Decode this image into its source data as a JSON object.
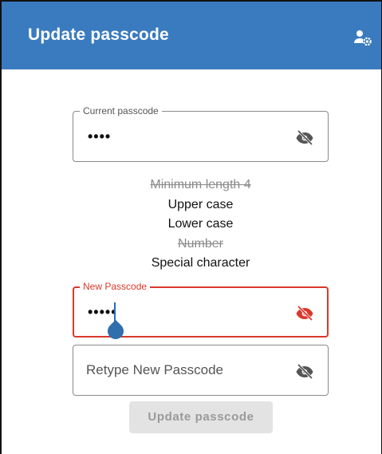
{
  "app_bar": {
    "title": "Update passcode",
    "background_color": "#3a7bbf",
    "action_icon": "account-settings-icon"
  },
  "current_passcode": {
    "label": "Current passcode",
    "value": "••••",
    "toggle_icon": "eye-off-icon"
  },
  "requirements": [
    {
      "text": "Minimum length 4",
      "met": true
    },
    {
      "text": "Upper case",
      "met": false
    },
    {
      "text": "Lower case",
      "met": false
    },
    {
      "text": "Number",
      "met": true
    },
    {
      "text": "Special character",
      "met": false
    }
  ],
  "new_passcode": {
    "label": "New Passcode",
    "value": "•••••",
    "state": "error",
    "accent_color": "#d9392b",
    "toggle_icon": "eye-off-icon"
  },
  "retype_passcode": {
    "placeholder": "Retype New Passcode",
    "toggle_icon": "eye-off-icon"
  },
  "submit_button": {
    "label": "Update passcode",
    "enabled": false
  }
}
